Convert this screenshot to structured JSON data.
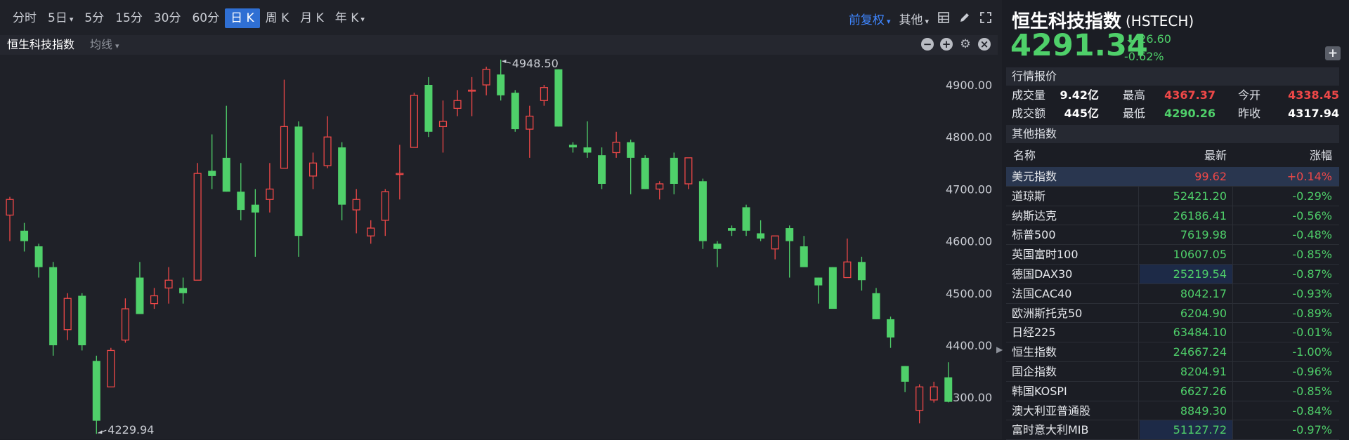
{
  "toolbar": {
    "periods": [
      "分时",
      "5日",
      "5分",
      "15分",
      "30分",
      "60分",
      "日 K",
      "周 K",
      "月 K",
      "年 K"
    ],
    "active_period": "日 K",
    "adjust_label": "前复权",
    "other_label": "其他",
    "icons": [
      "layout-icon",
      "pencil-icon",
      "fullscreen-icon"
    ]
  },
  "subbar": {
    "index_name": "恒生科技指数",
    "ma_label": "均线",
    "icons": [
      "minus-icon",
      "plus-icon",
      "gear-icon",
      "close-icon"
    ]
  },
  "quote": {
    "name": "恒生科技指数",
    "code": "(HSTECH)",
    "price": "4291.34",
    "change": "-26.60",
    "change_pct": "-0.62%",
    "section_market": "行情报价",
    "section_other": "其他指数",
    "stats": {
      "volume_label": "成交量",
      "volume": "9.42亿",
      "turnover_label": "成交额",
      "turnover": "445亿",
      "high_label": "最高",
      "high": "4367.37",
      "low_label": "最低",
      "low": "4290.26",
      "open_label": "今开",
      "open": "4338.45",
      "prev_close_label": "昨收",
      "prev_close": "4317.94"
    },
    "colors": {
      "up": "#f04848",
      "down": "#4fd06a",
      "accent": "#3f86ff"
    }
  },
  "indices": {
    "headers": {
      "name": "名称",
      "latest": "最新",
      "change": "涨幅"
    },
    "rows": [
      {
        "name": "美元指数",
        "latest": "99.62",
        "change": "+0.14%",
        "dir": "up",
        "selected": true
      },
      {
        "name": "道琼斯",
        "latest": "52421.20",
        "change": "-0.29%",
        "dir": "down"
      },
      {
        "name": "纳斯达克",
        "latest": "26186.41",
        "change": "-0.56%",
        "dir": "down"
      },
      {
        "name": "标普500",
        "latest": "7619.98",
        "change": "-0.48%",
        "dir": "down"
      },
      {
        "name": "英国富时100",
        "latest": "10607.05",
        "change": "-0.85%",
        "dir": "down"
      },
      {
        "name": "德国DAX30",
        "latest": "25219.54",
        "change": "-0.87%",
        "dir": "down",
        "highlight": true
      },
      {
        "name": "法国CAC40",
        "latest": "8042.17",
        "change": "-0.93%",
        "dir": "down"
      },
      {
        "name": "欧洲斯托克50",
        "latest": "6204.90",
        "change": "-0.89%",
        "dir": "down"
      },
      {
        "name": "日经225",
        "latest": "63484.10",
        "change": "-0.01%",
        "dir": "down"
      },
      {
        "name": "恒生指数",
        "latest": "24667.24",
        "change": "-1.00%",
        "dir": "down"
      },
      {
        "name": "国企指数",
        "latest": "8204.91",
        "change": "-0.96%",
        "dir": "down"
      },
      {
        "name": "韩国KOSPI",
        "latest": "6627.26",
        "change": "-0.85%",
        "dir": "down"
      },
      {
        "name": "澳大利亚普通股",
        "latest": "8849.30",
        "change": "-0.84%",
        "dir": "down"
      },
      {
        "name": "富时意大利MIB",
        "latest": "51127.72",
        "change": "-0.97%",
        "dir": "down",
        "highlight": true
      }
    ]
  },
  "chart_data": {
    "type": "candlestick",
    "ylim": [
      4220,
      4980
    ],
    "yticks": [
      "4900.00",
      "4800.00",
      "4700.00",
      "4600.00",
      "4500.00",
      "4400.00",
      "4300.00"
    ],
    "grid": false,
    "annotations": [
      {
        "text": "4948.50",
        "candle": 34,
        "value": 4948.5,
        "side": "top"
      },
      {
        "text": "4229.94",
        "candle": 6,
        "value": 4229.94,
        "side": "bottom"
      }
    ],
    "candles": [
      [
        4650,
        4680,
        4685,
        4600
      ],
      [
        4620,
        4600,
        4635,
        4580
      ],
      [
        4590,
        4550,
        4595,
        4530
      ],
      [
        4550,
        4400,
        4560,
        4380
      ],
      [
        4430,
        4490,
        4500,
        4410
      ],
      [
        4495,
        4400,
        4500,
        4390
      ],
      [
        4370,
        4255,
        4380,
        4229.94
      ],
      [
        4320,
        4390,
        4395,
        4320
      ],
      [
        4410,
        4470,
        4490,
        4405
      ],
      [
        4530,
        4460,
        4560,
        4460
      ],
      [
        4480,
        4495,
        4510,
        4470
      ],
      [
        4510,
        4525,
        4550,
        4480
      ],
      [
        4510,
        4500,
        4530,
        4480
      ],
      [
        4525,
        4730,
        4750,
        4525
      ],
      [
        4735,
        4725,
        4805,
        4700
      ],
      [
        4760,
        4695,
        4860,
        4695
      ],
      [
        4695,
        4660,
        4750,
        4640
      ],
      [
        4670,
        4655,
        4700,
        4570
      ],
      [
        4680,
        4700,
        4750,
        4655
      ],
      [
        4740,
        4820,
        4910,
        4740
      ],
      [
        4820,
        4610,
        4830,
        4570
      ],
      [
        4725,
        4750,
        4770,
        4700
      ],
      [
        4745,
        4800,
        4840,
        4740
      ],
      [
        4780,
        4670,
        4790,
        4640
      ],
      [
        4660,
        4680,
        4700,
        4615
      ],
      [
        4610,
        4625,
        4640,
        4595
      ],
      [
        4640,
        4695,
        4700,
        4610
      ],
      [
        4730,
        4730,
        4785,
        4680
      ],
      [
        4780,
        4880,
        4885,
        4780
      ],
      [
        4900,
        4810,
        4915,
        4800
      ],
      [
        4820,
        4830,
        4870,
        4770
      ],
      [
        4855,
        4870,
        4890,
        4840
      ],
      [
        4890,
        4890,
        4915,
        4840
      ],
      [
        4900,
        4930,
        4935,
        4880
      ],
      [
        4920,
        4880,
        4948.5,
        4870
      ],
      [
        4885,
        4815,
        4890,
        4810
      ],
      [
        4815,
        4840,
        4860,
        4760
      ],
      [
        4870,
        4895,
        4900,
        4860
      ],
      [
        4930,
        4820,
        4930,
        4820
      ],
      [
        4785,
        4780,
        4790,
        4770
      ],
      [
        4780,
        4770,
        4830,
        4760
      ],
      [
        4765,
        4710,
        4780,
        4700
      ],
      [
        4770,
        4790,
        4810,
        4760
      ],
      [
        4790,
        4760,
        4795,
        4690
      ],
      [
        4760,
        4700,
        4765,
        4700
      ],
      [
        4700,
        4710,
        4715,
        4680
      ],
      [
        4760,
        4710,
        4770,
        4690
      ],
      [
        4710,
        4760,
        4760,
        4700
      ],
      [
        4715,
        4600,
        4720,
        4585
      ],
      [
        4595,
        4585,
        4600,
        4550
      ],
      [
        4625,
        4620,
        4630,
        4610
      ],
      [
        4665,
        4620,
        4670,
        4610
      ],
      [
        4615,
        4605,
        4640,
        4600
      ],
      [
        4585,
        4610,
        4610,
        4565
      ],
      [
        4625,
        4600,
        4630,
        4530
      ],
      [
        4590,
        4550,
        4610,
        4560
      ],
      [
        4530,
        4515,
        4530,
        4480
      ],
      [
        4550,
        4470,
        4550,
        4470
      ],
      [
        4530,
        4560,
        4605,
        4530
      ],
      [
        4560,
        4525,
        4570,
        4505
      ],
      [
        4500,
        4450,
        4510,
        4450
      ],
      [
        4450,
        4415,
        4455,
        4395
      ],
      [
        4360,
        4330,
        4360,
        4310
      ],
      [
        4275,
        4320,
        4325,
        4250
      ],
      [
        4295,
        4320,
        4330,
        4290
      ],
      [
        4338.45,
        4291.34,
        4367.37,
        4290.26
      ]
    ]
  }
}
